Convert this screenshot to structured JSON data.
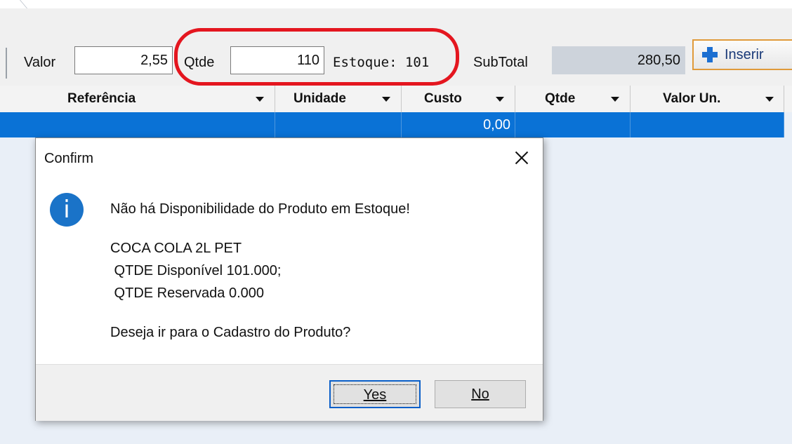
{
  "toolbar": {
    "valor_label": "Valor",
    "valor_value": "2,55",
    "qtde_label": "Qtde",
    "qtde_value": "110",
    "estoque_text": "Estoque: 101",
    "subtotal_label": "SubTotal",
    "subtotal_value": "280,50",
    "inserir_label": "Inserir"
  },
  "grid": {
    "columns": [
      "Referência",
      "Unidade",
      "Custo",
      "Qtde",
      "Valor Un."
    ],
    "row": {
      "custo": "0,00"
    }
  },
  "dialog": {
    "title": "Confirm",
    "icon": "info-icon",
    "message_line1": "Não há Disponibilidade do Produto em Estoque!",
    "product_name": "COCA COLA 2L PET",
    "qtde_disponivel": " QTDE Disponível 101.000;",
    "qtde_reservada": " QTDE Reservada 0.000",
    "question": "Deseja ir para o Cadastro do Produto?",
    "yes_label": "Yes",
    "no_label": "No"
  },
  "colors": {
    "highlight": "#e4161f",
    "selected_row": "#0a72d6",
    "info_icon": "#1a73c8"
  }
}
